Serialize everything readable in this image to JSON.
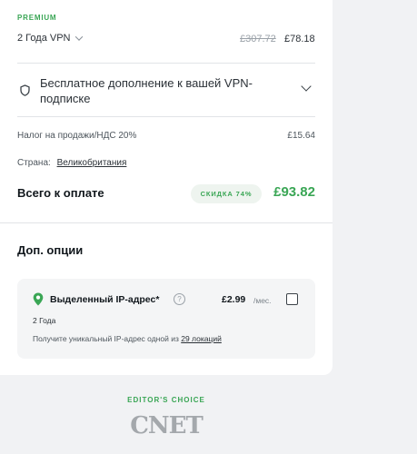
{
  "plan": {
    "label": "PREMIUM",
    "selected": "2 Года VPN",
    "price_old": "£307.72",
    "price_new": "£78.18"
  },
  "addon": {
    "text": "Бесплатное дополнение к вашей VPN-подписке"
  },
  "tax": {
    "label": "Налог на продажи/НДС 20%",
    "value": "£15.64"
  },
  "country": {
    "label": "Страна:",
    "value": "Великобритания"
  },
  "total": {
    "label": "Всего к оплате",
    "discount": "СКИДКА 74%",
    "value": "£93.82"
  },
  "options": {
    "title": "Доп. опции",
    "item": {
      "name": "Выделенный IP-адрес*",
      "price": "£2.99",
      "per": "/мес.",
      "period": "2 Года",
      "desc_prefix": "Получите уникальный IP-адрес одной из",
      "desc_link": "29 локаций",
      "checked": false
    }
  },
  "badge": {
    "editors_choice": "EDITOR'S CHOICE",
    "cnet": "CNET"
  },
  "colors": {
    "accent_green": "#3aa655",
    "background": "#f1f2f4"
  }
}
